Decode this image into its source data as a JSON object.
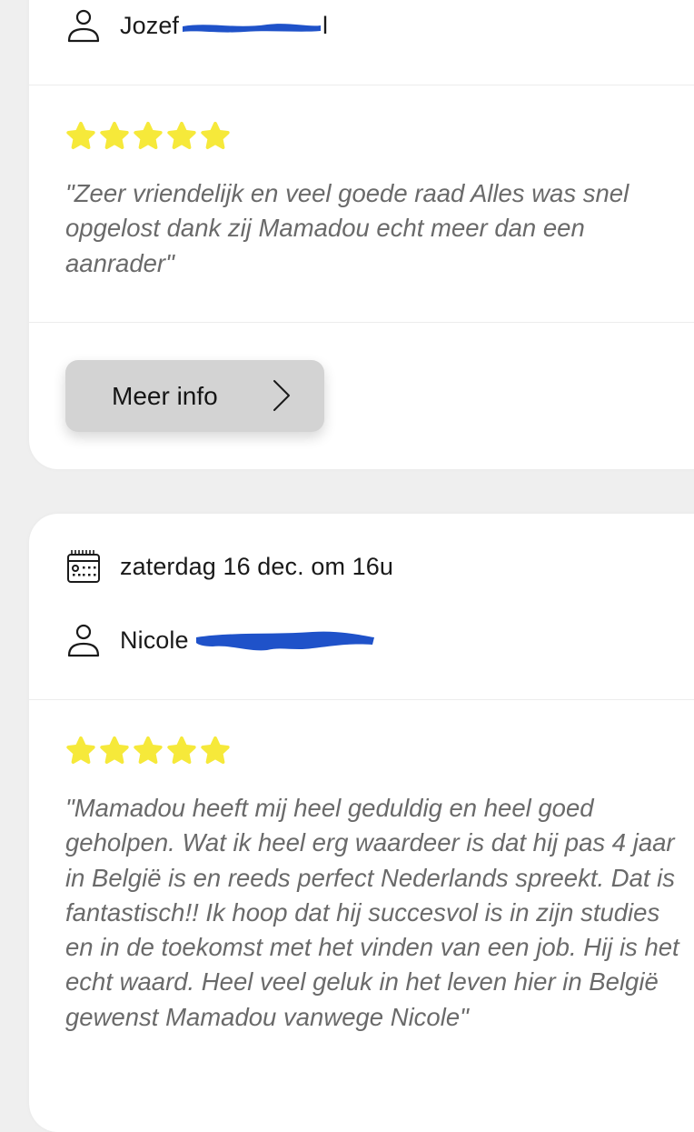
{
  "reviews": [
    {
      "name_visible": "Jozef",
      "name_suffix": "l",
      "rating": 5,
      "quote": "\"Zeer vriendelijk en veel goede raad Alles was snel opgelost dank zij Mamadou echt meer dan een aanrader\"",
      "button_label": "Meer info"
    },
    {
      "date": "zaterdag 16 dec. om 16u",
      "name_visible": "Nicole",
      "rating": 5,
      "quote": "\"Mamadou heeft mij heel geduldig en heel goed geholpen. Wat ik heel erg waardeer is dat hij pas 4 jaar in België is en reeds perfect Nederlands spreekt. Dat is fantastisch!! Ik hoop dat hij succesvol is in zijn studies en in de toekomst met het vinden van een job. Hij is het echt waard. Heel veel geluk in het leven hier in België gewenst Mamadou vanwege Nicole\""
    }
  ],
  "icons": {
    "user": "user-icon",
    "calendar": "calendar-icon",
    "star": "star-icon",
    "chevron": "chevron-right-icon"
  },
  "colors": {
    "star": "#f6e93a",
    "redaction": "#1f52c9",
    "button_bg": "#d3d3d3",
    "card_bg": "#ffffff",
    "page_bg": "#efefef",
    "quote_text": "#6a6a6a"
  }
}
